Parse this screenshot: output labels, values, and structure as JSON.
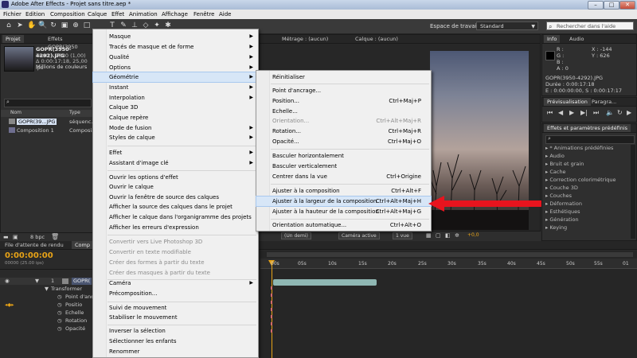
{
  "window": {
    "title": "Adobe After Effects - Projet sans titre.aep *"
  },
  "menubar": [
    "Fichier",
    "Edition",
    "Composition",
    "Calque",
    "Effet",
    "Animation",
    "Affichage",
    "Fenêtre",
    "Aide"
  ],
  "toolbar": {
    "workspace_label": "Espace de travail :",
    "workspace_value": "Standard",
    "search_placeholder": "Rechercher dans l'aide"
  },
  "project": {
    "tabs": [
      "Projet",
      "Effets GOPR(3950"
    ],
    "file_name": "GOPR(3950-4292).JPG",
    "resolution": "3840 x 2880 (1,00)",
    "duration": "Δ 0:00:17:18, 25,00 ips",
    "colors": "Millions de couleurs",
    "columns": [
      "Nom",
      "Type"
    ],
    "items": [
      {
        "name": "GOPR(39...JPG",
        "type": "séquenc..."
      },
      {
        "name": "Composition 1",
        "type": "Composi..."
      }
    ],
    "bpc": "8 bpc"
  },
  "viewer_tabs": [
    "Métrage : (aucun)",
    "Calque : (aucun)"
  ],
  "viewer_controls": {
    "resolution": "(Un demi)",
    "camera": "Caméra active",
    "views": "1 vue",
    "exposure": "+0,0"
  },
  "info": {
    "tabs": [
      "Info",
      "Audio"
    ],
    "r": "R :",
    "g": "G :",
    "b": "B :",
    "a": "A : 0",
    "x": "X : -144",
    "y": "Y : 626",
    "file": "GOPR(3950-4292).JPG",
    "duration": "Durée : 0:00:17:18",
    "range": "E : 0:00:00:00, S : 0:00:17:17"
  },
  "preview": {
    "title": "Prévisualisation",
    "tab2": "Paragra..."
  },
  "effects_panel": {
    "title": "Effets et paramètres prédéfinis",
    "items": [
      "* Animations prédéfinies",
      "Audio",
      "Bruit et grain",
      "Cache",
      "Correction colorimétrique",
      "Couche 3D",
      "Couches",
      "Déformation",
      "Esthétiques",
      "Génération",
      "Keying"
    ]
  },
  "timeline": {
    "tabs": [
      "File d'attente de rendu",
      "Comp"
    ],
    "timecode": "0:00:00:00",
    "fps": "00000 (25.00 ips)",
    "layer_index": "1",
    "layer_name": "GOPR(",
    "transform": "Transformer",
    "props": [
      "Point d'anc",
      "Positio",
      "Echelle",
      "Rotation",
      "Opacité"
    ],
    "ruler": [
      "00s",
      "05s",
      "10s",
      "15s",
      "20s",
      "25s",
      "30s",
      "35s",
      "40s",
      "45s",
      "50s",
      "55s",
      "01"
    ]
  },
  "context_menu": {
    "items": [
      {
        "label": "Masque",
        "submenu": true
      },
      {
        "label": "Tracés de masque et de forme",
        "submenu": true
      },
      {
        "label": "Qualité",
        "submenu": true
      },
      {
        "label": "Options",
        "submenu": true
      },
      {
        "label": "Géométrie",
        "submenu": true,
        "highlight": true
      },
      {
        "label": "Instant",
        "submenu": true
      },
      {
        "label": "Interpolation",
        "submenu": true
      },
      {
        "label": "Calque 3D"
      },
      {
        "label": "Calque repère"
      },
      {
        "label": "Mode de fusion",
        "submenu": true
      },
      {
        "label": "Styles de calque",
        "submenu": true
      },
      {
        "label": "Effet",
        "submenu": true
      },
      {
        "label": "Assistant d'image clé",
        "submenu": true
      },
      {
        "label": "Ouvrir les options d'effet"
      },
      {
        "label": "Ouvrir le calque"
      },
      {
        "label": "Ouvrir la fenêtre de source des calques"
      },
      {
        "label": "Afficher la source des calques dans le projet"
      },
      {
        "label": "Afficher le calque dans l'organigramme des projets"
      },
      {
        "label": "Afficher les erreurs d'expression"
      },
      {
        "label": "Convertir vers Live Photoshop 3D",
        "disabled": true
      },
      {
        "label": "Convertir en texte modifiable",
        "disabled": true
      },
      {
        "label": "Créer des formes à partir du texte",
        "disabled": true
      },
      {
        "label": "Créer des masques à partir du texte",
        "disabled": true
      },
      {
        "label": "Caméra",
        "submenu": true
      },
      {
        "label": "Précomposition..."
      },
      {
        "label": "Suivi de mouvement"
      },
      {
        "label": "Stabiliser le mouvement"
      },
      {
        "label": "Inverser la sélection"
      },
      {
        "label": "Sélectionner les enfants"
      },
      {
        "label": "Renommer"
      }
    ]
  },
  "geometry_submenu": {
    "items": [
      {
        "label": "Réinitialiser",
        "shortcut": ""
      },
      {
        "label": "Point d'ancrage...",
        "shortcut": ""
      },
      {
        "label": "Position...",
        "shortcut": "Ctrl+Maj+P"
      },
      {
        "label": "Echelle...",
        "shortcut": ""
      },
      {
        "label": "Orientation...",
        "shortcut": "Ctrl+Alt+Maj+R",
        "disabled": true
      },
      {
        "label": "Rotation...",
        "shortcut": "Ctrl+Maj+R"
      },
      {
        "label": "Opacité...",
        "shortcut": "Ctrl+Maj+O"
      },
      {
        "label": "Basculer horizontalement",
        "shortcut": ""
      },
      {
        "label": "Basculer verticalement",
        "shortcut": ""
      },
      {
        "label": "Centrer dans la vue",
        "shortcut": "Ctrl+Origine"
      },
      {
        "label": "Ajuster à la composition",
        "shortcut": "Ctrl+Alt+F"
      },
      {
        "label": "Ajuster à la largeur de la composition",
        "shortcut": "Ctrl+Alt+Maj+H",
        "highlight": true
      },
      {
        "label": "Ajuster à la hauteur de la composition",
        "shortcut": "Ctrl+Alt+Maj+G"
      },
      {
        "label": "Orientation automatique...",
        "shortcut": "Ctrl+Alt+O"
      }
    ]
  },
  "colors": {
    "annotation_arrow": "#e8141e",
    "menu_highlight": "#d7e6f7",
    "timecode": "#e8a317"
  }
}
